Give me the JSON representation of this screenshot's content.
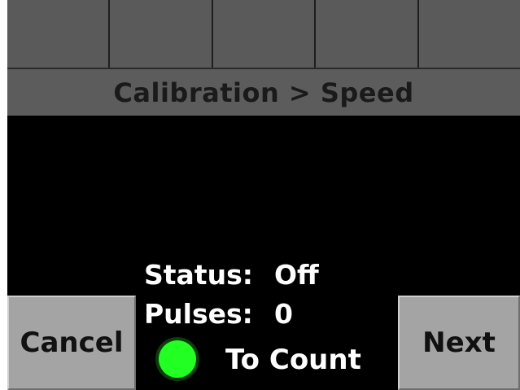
{
  "header": {
    "top_keys": [
      "",
      "",
      "",
      "",
      ""
    ],
    "title": "Calibration > Speed"
  },
  "status": {
    "status_label": "Status:",
    "status_value": "Off",
    "pulses_label": "Pulses:",
    "pulses_value": "0"
  },
  "indicator": {
    "color": "#22ff22",
    "label": "To Count"
  },
  "buttons": {
    "cancel_label": "Cancel",
    "next_label": "Next"
  },
  "colors": {
    "background": "#000000",
    "key_gray": "#5a5a5a",
    "button_gray": "#a4a4a4"
  }
}
